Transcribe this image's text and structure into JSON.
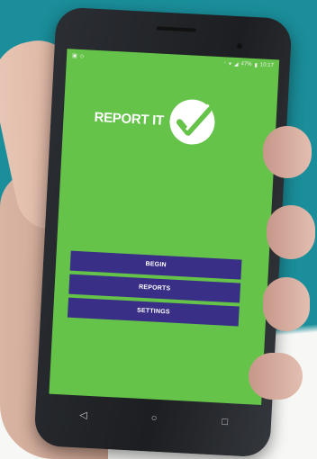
{
  "app": {
    "title": "REPORT IT",
    "brand_color": "#65c34a",
    "button_color": "#3a2f86"
  },
  "statusbar": {
    "left_icons": [
      "image-icon",
      "notification-icon"
    ],
    "battery": "47%",
    "time": "10:17"
  },
  "menu": {
    "begin_label": "BEGIN",
    "reports_label": "REPORTS",
    "settings_label": "SETTINGS"
  },
  "navigation": {
    "back_glyph": "◁",
    "home_glyph": "○",
    "recents_glyph": "□"
  }
}
